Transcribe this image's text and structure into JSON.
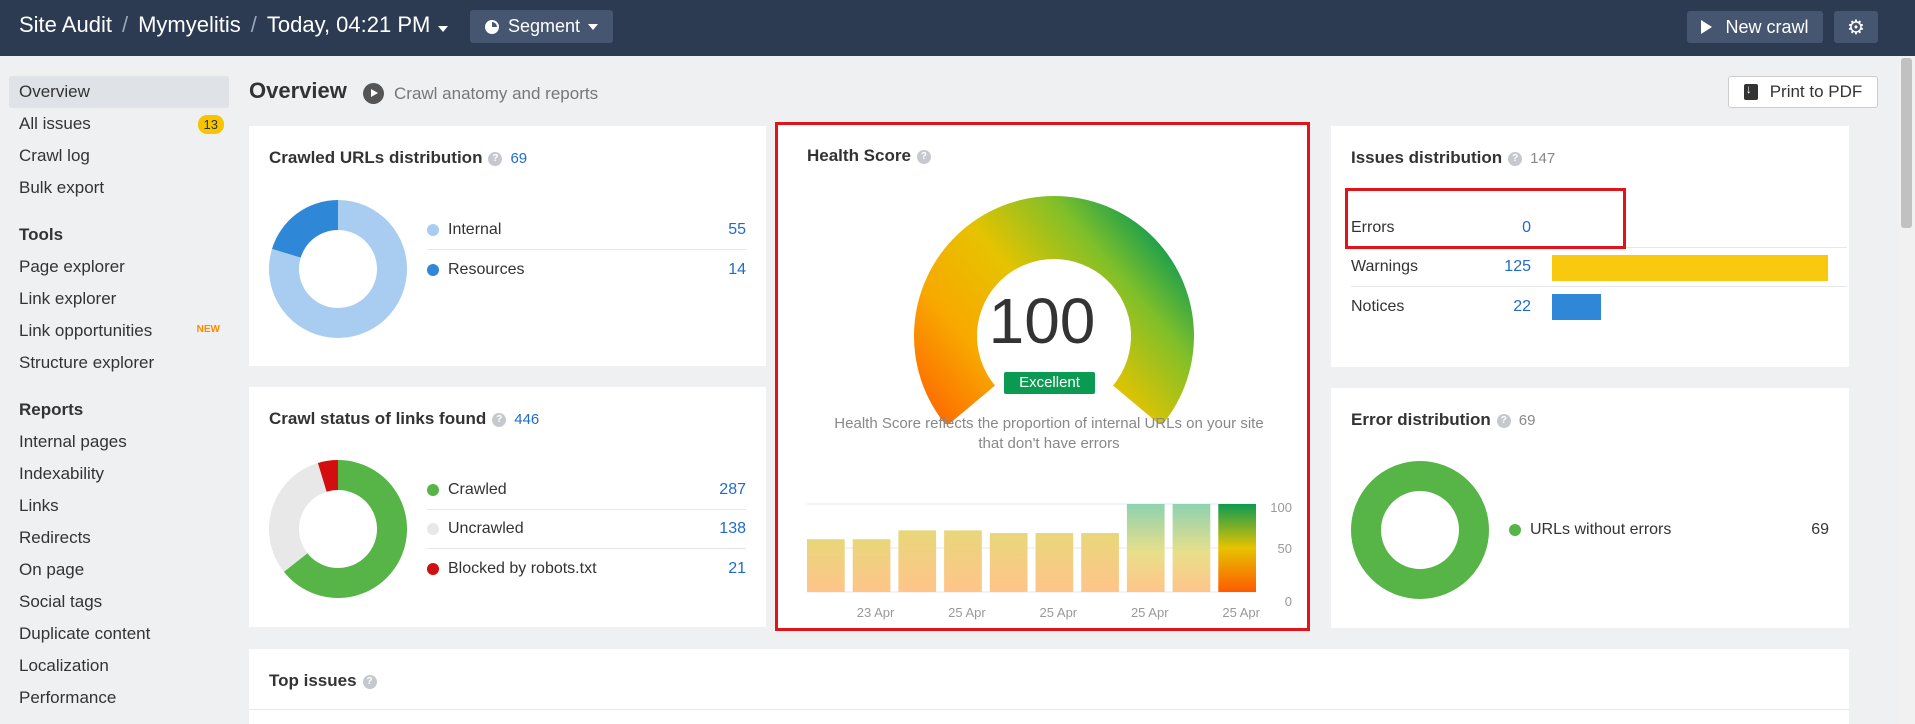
{
  "topbar": {
    "site_audit": "Site Audit",
    "project": "Mymyelitis",
    "crawl_date": "Today, 04:21 PM",
    "segment_label": "Segment",
    "new_crawl_label": "New crawl",
    "gear_icon": "gear-icon"
  },
  "sidebar": {
    "items": [
      {
        "label": "Overview",
        "active": true
      },
      {
        "label": "All issues",
        "badge": "13"
      },
      {
        "label": "Crawl log"
      },
      {
        "label": "Bulk export"
      }
    ],
    "tools_heading": "Tools",
    "tools": [
      {
        "label": "Page explorer"
      },
      {
        "label": "Link explorer"
      },
      {
        "label": "Link opportunities",
        "tag": "NEW"
      },
      {
        "label": "Structure explorer"
      }
    ],
    "reports_heading": "Reports",
    "reports": [
      {
        "label": "Internal pages"
      },
      {
        "label": "Indexability"
      },
      {
        "label": "Links"
      },
      {
        "label": "Redirects"
      },
      {
        "label": "On page"
      },
      {
        "label": "Social tags"
      },
      {
        "label": "Duplicate content"
      },
      {
        "label": "Localization"
      },
      {
        "label": "Performance"
      }
    ]
  },
  "header": {
    "title": "Overview",
    "subtitle": "Crawl anatomy and reports",
    "print_label": "Print to PDF"
  },
  "crawled_urls": {
    "title": "Crawled URLs distribution",
    "total": "69",
    "rows": [
      {
        "label": "Internal",
        "value": "55",
        "color": "#a9cdf0"
      },
      {
        "label": "Resources",
        "value": "14",
        "color": "#2f87d8"
      }
    ]
  },
  "crawl_status": {
    "title": "Crawl status of links found",
    "total": "446",
    "rows": [
      {
        "label": "Crawled",
        "value": "287",
        "color": "#57b446"
      },
      {
        "label": "Uncrawled",
        "value": "138",
        "color": "#e8e8e8"
      },
      {
        "label": "Blocked by robots.txt",
        "value": "21",
        "color": "#d30e0e"
      }
    ]
  },
  "health_score": {
    "title": "Health Score",
    "score": "100",
    "rating": "Excellent",
    "description": "Health Score reflects the proportion of internal URLs on your site that don't have errors"
  },
  "chart_data": {
    "type": "bar",
    "categories": [
      "",
      "23 Apr",
      "",
      "25 Apr",
      "",
      "25 Apr",
      "",
      "25 Apr",
      "",
      "25 Apr"
    ],
    "x_tick_labels": [
      "23 Apr",
      "25 Apr",
      "25 Apr",
      "25 Apr",
      "25 Apr"
    ],
    "values": [
      60,
      60,
      70,
      70,
      67,
      67,
      67,
      100,
      100,
      100
    ],
    "y_ticks": [
      "100",
      "50",
      "0"
    ],
    "ylim": [
      0,
      100
    ]
  },
  "issues_distribution": {
    "title": "Issues distribution",
    "total": "147",
    "max": 125,
    "rows": [
      {
        "label": "Errors",
        "value": 0,
        "color": "#d30e0e"
      },
      {
        "label": "Warnings",
        "value": 125,
        "color": "#f9c910"
      },
      {
        "label": "Notices",
        "value": 22,
        "color": "#2f87d8"
      }
    ]
  },
  "error_distribution": {
    "title": "Error distribution",
    "total": "69",
    "rows": [
      {
        "label": "URLs without errors",
        "value": "69",
        "color": "#57b446"
      }
    ]
  },
  "top_issues": {
    "title": "Top issues"
  }
}
